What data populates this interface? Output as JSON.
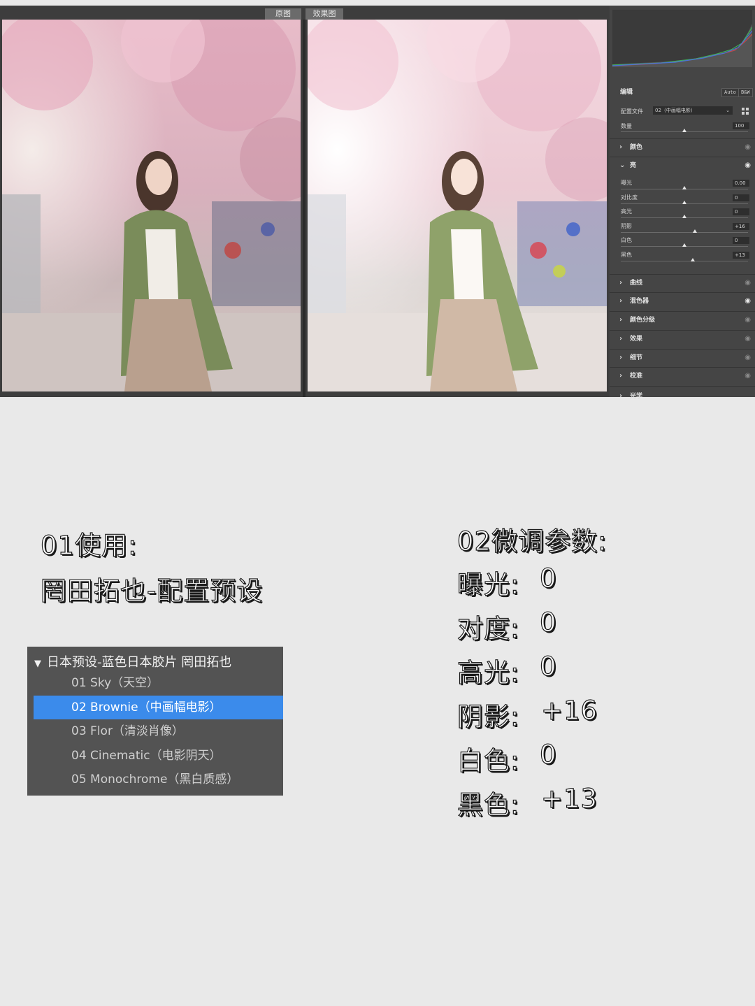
{
  "compare_tabs": {
    "before": "原图",
    "after": "效果图"
  },
  "panel": {
    "edit_title": "编辑",
    "auto_button": "Auto",
    "bw_button": "B&W",
    "profile_label": "配置文件",
    "profile_value": "02（中画幅电影）",
    "amount_label": "数量",
    "amount_value": "100",
    "sections": {
      "color": "颜色",
      "light": "亮",
      "curve": "曲线",
      "mixer": "混色器",
      "grading": "颜色分级",
      "effects": "效果",
      "detail": "细节",
      "calibration": "校准",
      "optics": "光学"
    },
    "light_rows": [
      {
        "label": "曝光",
        "value": "0.00",
        "pos": 0.5
      },
      {
        "label": "对比度",
        "value": "0",
        "pos": 0.5
      },
      {
        "label": "高光",
        "value": "0",
        "pos": 0.5
      },
      {
        "label": "阴影",
        "value": "+16",
        "pos": 0.58
      },
      {
        "label": "白色",
        "value": "0",
        "pos": 0.5
      },
      {
        "label": "黑色",
        "value": "+13",
        "pos": 0.565
      }
    ],
    "histogram_colors": {
      "red": "#c84a4a",
      "green": "#3fae5a",
      "blue": "#4a72d8",
      "gray": "#8a8a8a"
    }
  },
  "info": {
    "step1_title": "01使用:",
    "step1_subtitle": "罔田拓也-配置预设",
    "step2_title": "02微调参数:",
    "params": [
      {
        "label": "曝光:",
        "value": "0"
      },
      {
        "label": "对度:",
        "value": "0"
      },
      {
        "label": "高光:",
        "value": "0"
      },
      {
        "label": "阴影:",
        "value": "+16"
      },
      {
        "label": "白色:",
        "value": "0"
      },
      {
        "label": "黑色:",
        "value": "+13"
      }
    ]
  },
  "preset_list": {
    "group_name": "日本预设-蓝色日本胶片 罔田拓也",
    "items": [
      "01 Sky（天空）",
      "02 Brownie（中画幅电影）",
      "03 Flor（清淡肖像）",
      "04 Cinematic（电影阴天）",
      "05 Monochrome（黑白质感）"
    ],
    "selected_index": 1,
    "selected_color": "#3b8beb"
  }
}
